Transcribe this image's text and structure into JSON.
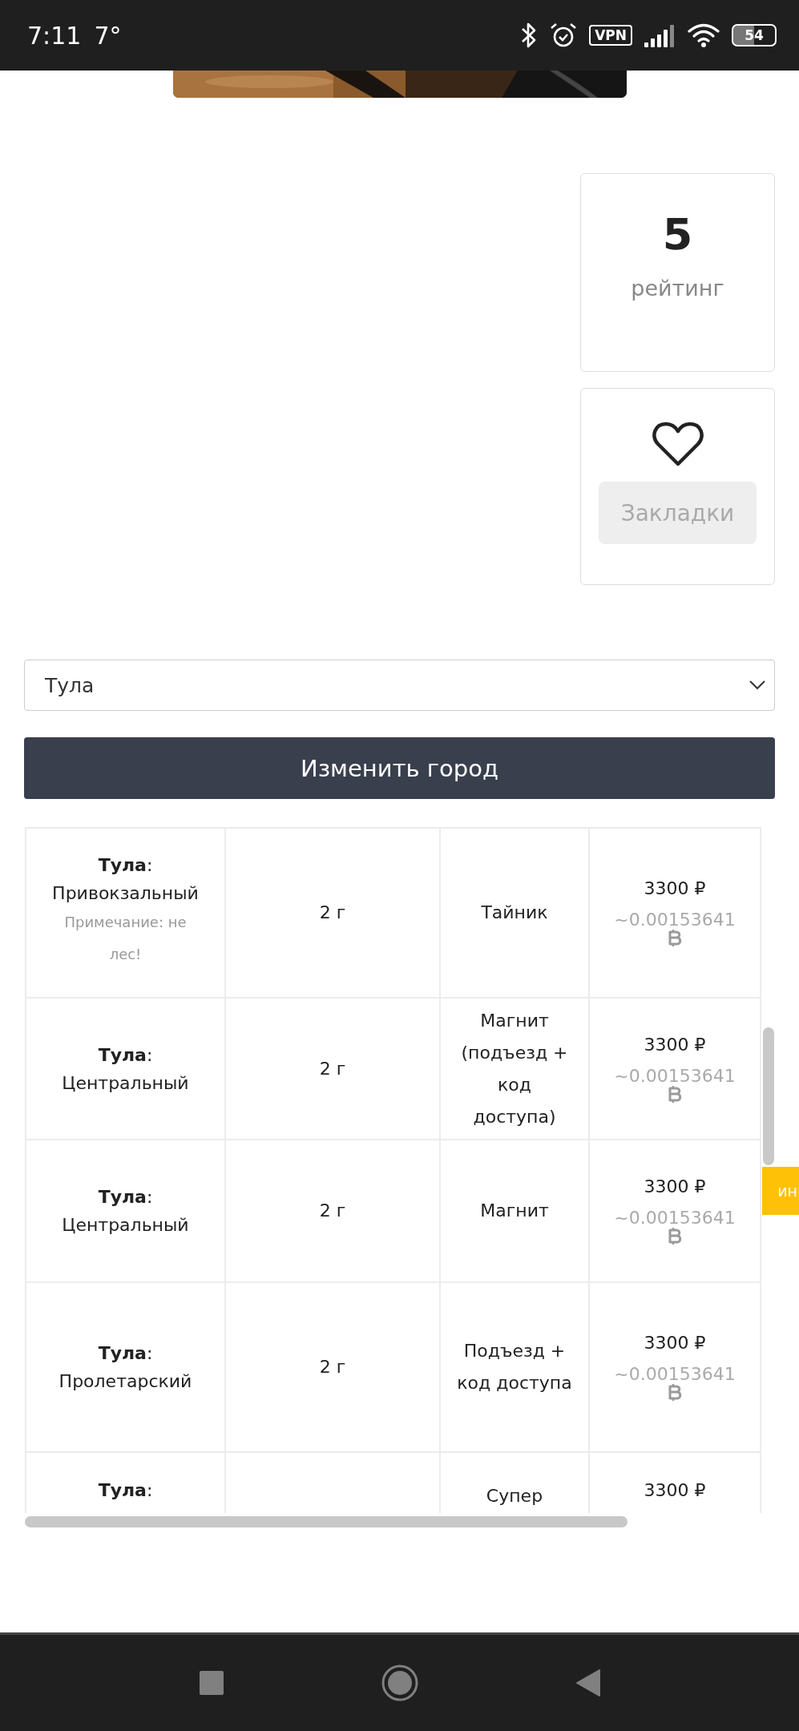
{
  "status_bar": {
    "time": "7:11",
    "temperature": "7°",
    "vpn_label": "VPN",
    "battery": "54"
  },
  "rating": {
    "value": "5",
    "label": "рейтинг"
  },
  "bookmarks": {
    "button": "Закладки"
  },
  "city_select": {
    "value": "Тула"
  },
  "change_city_button": "Изменить город",
  "side_tab": {
    "label": "ин"
  },
  "table": {
    "rows": [
      {
        "city": "**Тула**:",
        "district": "Привокзальный",
        "note": "Примечание: не лес!",
        "weight": "2 г",
        "method": "Тайник",
        "price": "3300 ₽",
        "btc": "~0.00153641"
      },
      {
        "city": "**Тула**:",
        "district": "Центральный",
        "weight": "2 г",
        "method": "Магнит (подъезд + код доступа)",
        "price": "3300 ₽",
        "btc": "~0.00153641"
      },
      {
        "city": "**Тула**:",
        "district": "Центральный",
        "weight": "2 г",
        "method": "Магнит",
        "price": "3300 ₽",
        "btc": "~0.00153641"
      },
      {
        "city": "**Тула**:",
        "district": "Пролетарский",
        "weight": "2 г",
        "method": "Подъезд + код доступа",
        "price": "3300 ₽",
        "btc": "~0.00153641"
      },
      {
        "city": "**Тула**:",
        "method": "Супер",
        "price": "3300 ₽"
      }
    ]
  }
}
